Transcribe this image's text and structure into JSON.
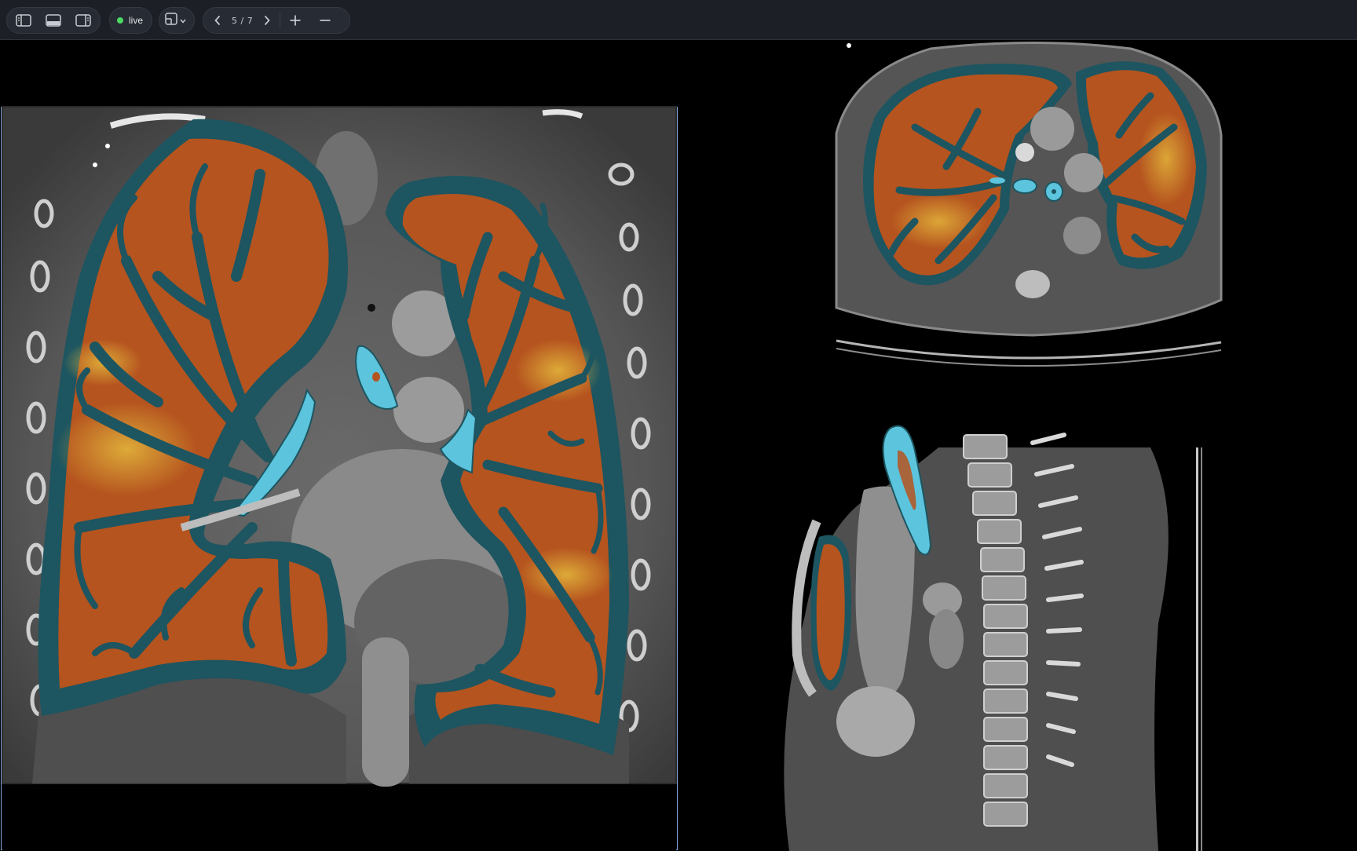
{
  "toolbar": {
    "layout_buttons": [
      {
        "icon": "sidebar-left-icon"
      },
      {
        "icon": "panel-bottom-icon"
      },
      {
        "icon": "sidebar-right-icon"
      }
    ],
    "live": {
      "label": "live",
      "dot_color": "#4cd964"
    },
    "layout_selector": {
      "icon": "layout-grid-icon",
      "dropdown_icon": "chevron-down-icon"
    },
    "pager": {
      "prev_icon": "chevron-left-icon",
      "current": "5",
      "separator": "/",
      "total": "7",
      "next_icon": "chevron-right-icon"
    },
    "zoom": {
      "in_icon": "plus-icon",
      "out_icon": "minus-icon"
    }
  },
  "viewports": [
    {
      "name": "coronal",
      "active": true
    },
    {
      "name": "axial",
      "active": false
    },
    {
      "name": "sagittal",
      "active": false
    }
  ],
  "overlay_colors": {
    "lung_segmentation": "#b5541f",
    "lung_border": "#1d5560",
    "airway": "#5cc4dd",
    "emphysema_highlight": "#e0b33a",
    "active_border": "#7fa3d8"
  }
}
